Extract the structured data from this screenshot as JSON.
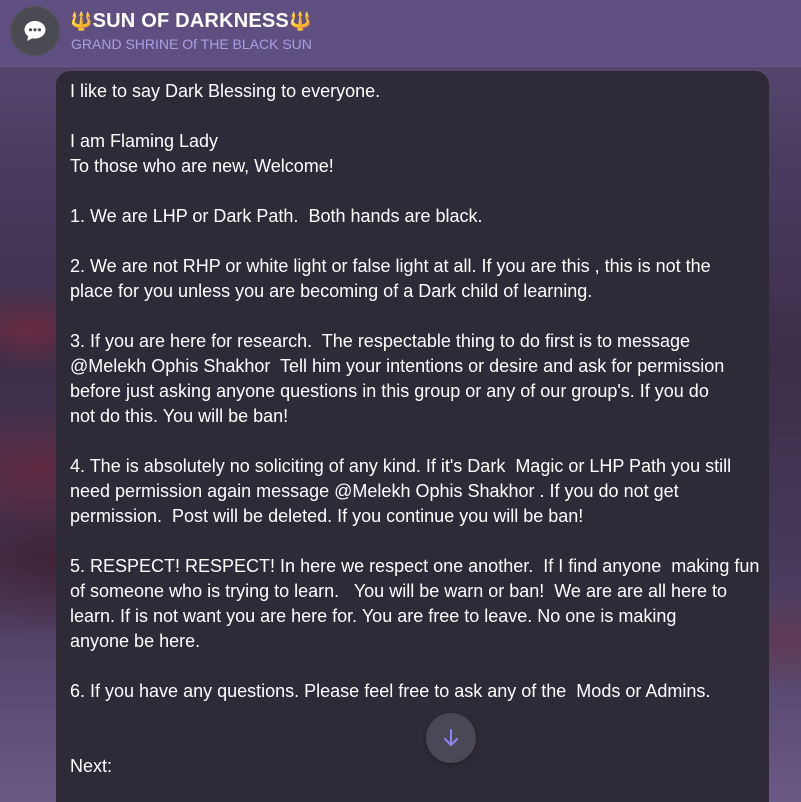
{
  "header": {
    "title_emoji_left": "🔱",
    "title_text": "SUN OF DARKNESS",
    "title_emoji_right": "🔱",
    "subtitle": "GRAND SHRINE Of THE BLACK SUN",
    "avatar_icon": "chat-bubble-icon"
  },
  "message": {
    "lines": [
      "I like to say Dark Blessing to everyone.",
      "",
      "I am Flaming Lady",
      "To those who are new, Welcome!",
      "",
      "1. We are LHP or Dark Path.  Both hands are black.",
      "",
      "2. We are not RHP or white light or false light at all. If you are this , this is not the",
      "place for you unless you are becoming of a Dark child of learning.",
      "",
      "3. If you are here for research.  The respectable thing to do first is to message",
      "@Melekh Ophis Shakhor  Tell him your intentions or desire and ask for permission",
      "before just asking anyone questions in this group or any of our group's. If you do",
      "not do this. You will be ban!",
      "",
      "4. The is absolutely no soliciting of any kind. If it's Dark  Magic or LHP Path you still",
      "need permission again message @Melekh Ophis Shakhor . If you do not get",
      "permission.  Post will be deleted. If you continue you will be ban!",
      "",
      "5. RESPECT! RESPECT! In here we respect one another.  If I find anyone  making fun",
      "of someone who is trying to learn.   You will be warn or ban!  We are are all here to",
      "learn. If is not want you are here for. You are free to leave. No one is making",
      "anyone be here.",
      "",
      "6. If you have any questions. Please feel free to ask any of the  Mods or Admins.",
      "",
      "",
      "Next:"
    ]
  },
  "scroll_button": {
    "icon": "arrow-down-icon"
  },
  "colors": {
    "header_bg": "#5f5082",
    "subtitle": "#a99fe0",
    "bubble_bg": "#2f2a37",
    "accent_arrow": "#8d86f0"
  }
}
